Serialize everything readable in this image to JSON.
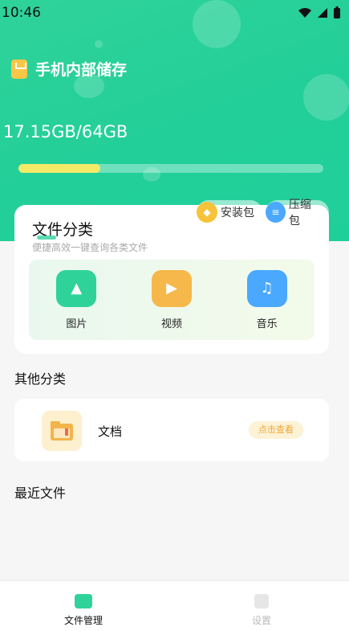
{
  "status": {
    "time": "10:46"
  },
  "storage": {
    "title": "手机内部储存",
    "amount": "17.15GB/64GB",
    "used_fraction": 0.268
  },
  "categories": {
    "title": "文件分类",
    "subtitle": "便捷高效一键查询各类文件",
    "chips": [
      {
        "label": "安装包",
        "icon": "package-icon"
      },
      {
        "label": "压缩包",
        "icon": "zip-icon"
      }
    ],
    "tiles": [
      {
        "label": "图片",
        "icon": "image-icon",
        "color": "#2fd39a"
      },
      {
        "label": "视频",
        "icon": "video-icon",
        "color": "#f6b84a"
      },
      {
        "label": "音乐",
        "icon": "music-icon",
        "color": "#4aa8ff"
      }
    ]
  },
  "other": {
    "title": "其他分类",
    "doc_label": "文档",
    "view_button": "点击查看"
  },
  "recent": {
    "title": "最近文件"
  },
  "nav": {
    "files": "文件管理",
    "settings": "设置"
  },
  "colors": {
    "accent": "#2fd39a",
    "bar_fill": "#f4ea68"
  }
}
